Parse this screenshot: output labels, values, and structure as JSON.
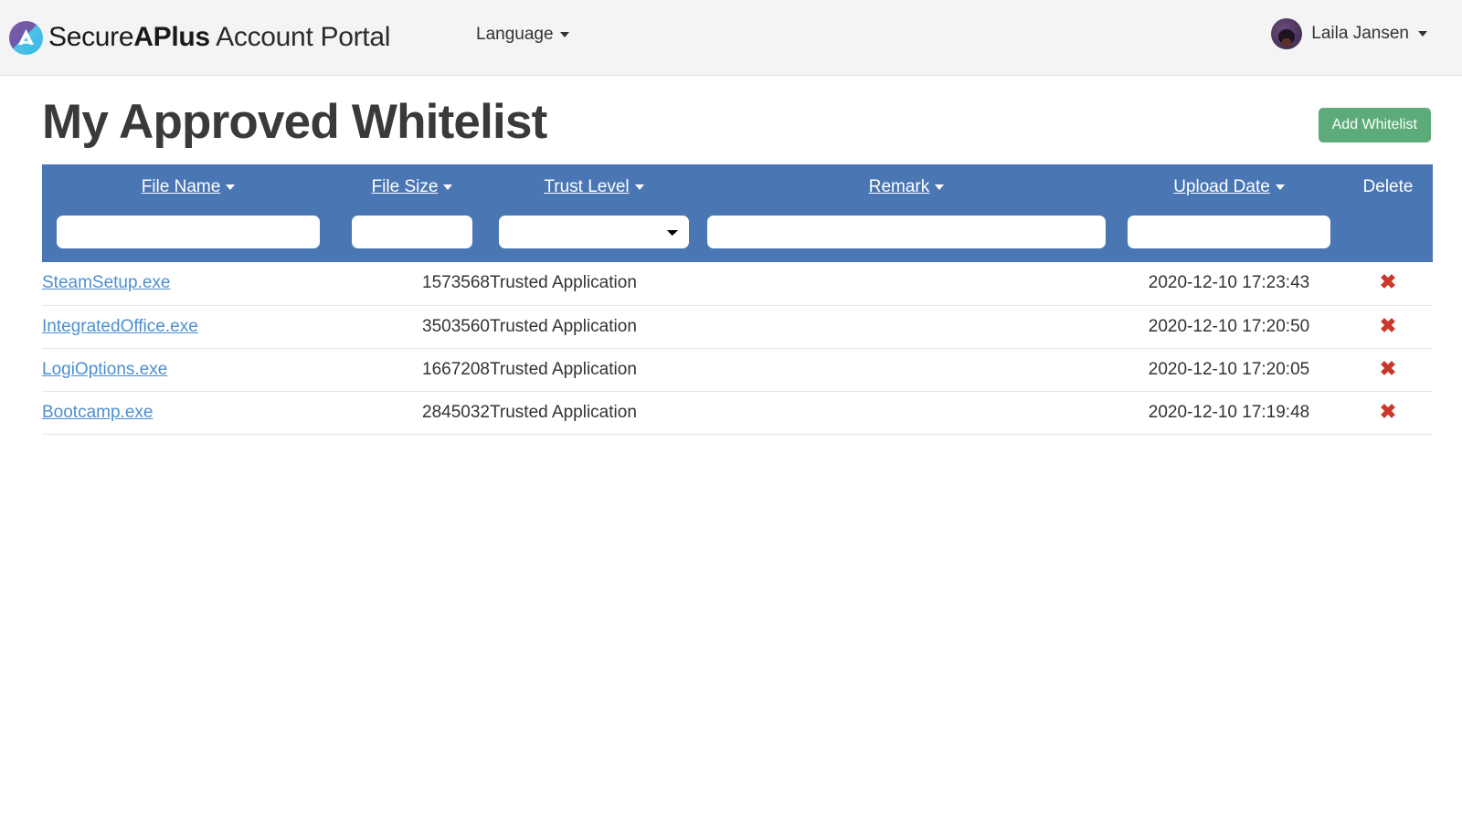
{
  "navbar": {
    "brand_secure": "Secure",
    "brand_aplus": "APlus",
    "brand_portal": " Account Portal",
    "logo_icon": "secureaplus-logo-icon",
    "language_label": "Language",
    "language_caret_icon": "caret-down-icon",
    "user_name": "Laila Jansen",
    "user_caret_icon": "caret-down-icon",
    "avatar_icon": "user-avatar"
  },
  "page": {
    "title": "My Approved Whitelist",
    "add_button_label": "Add Whitelist"
  },
  "table": {
    "columns": [
      {
        "label": "File Name",
        "sortable": true,
        "caret_icon": "caret-down-icon"
      },
      {
        "label": "File Size",
        "sortable": true,
        "caret_icon": "caret-down-icon"
      },
      {
        "label": "Trust Level",
        "sortable": true,
        "caret_icon": "caret-down-icon"
      },
      {
        "label": "Remark",
        "sortable": true,
        "caret_icon": "caret-down-icon"
      },
      {
        "label": "Upload Date",
        "sortable": true,
        "caret_icon": "caret-down-icon"
      },
      {
        "label": "Delete",
        "sortable": false,
        "caret_icon": ""
      }
    ],
    "filters": {
      "file_name_value": "",
      "file_name_placeholder": "",
      "file_size_value": "",
      "file_size_placeholder": "",
      "trust_level_selected": "",
      "trust_level_options": [
        ""
      ],
      "remark_value": "",
      "remark_placeholder": "",
      "upload_date_value": "",
      "upload_date_placeholder": ""
    },
    "rows": [
      {
        "file_name": "SteamSetup.exe",
        "file_size": "1573568",
        "trust_level": "Trusted Application",
        "remark": "",
        "upload_date": "2020-12-10 17:23:43",
        "delete_icon": "✖"
      },
      {
        "file_name": "IntegratedOffice.exe",
        "file_size": "3503560",
        "trust_level": "Trusted Application",
        "remark": "",
        "upload_date": "2020-12-10 17:20:50",
        "delete_icon": "✖"
      },
      {
        "file_name": "LogiOptions.exe",
        "file_size": "1667208",
        "trust_level": "Trusted Application",
        "remark": "",
        "upload_date": "2020-12-10 17:20:05",
        "delete_icon": "✖"
      },
      {
        "file_name": "Bootcamp.exe",
        "file_size": "2845032",
        "trust_level": "Trusted Application",
        "remark": "",
        "upload_date": "2020-12-10 17:19:48",
        "delete_icon": "✖"
      }
    ]
  },
  "colors": {
    "header_blue": "#4a77b4",
    "add_button_green": "#5cab78",
    "link_blue": "#4e8fd1",
    "delete_red": "#c9392b",
    "navbar_bg": "#f4f4f4"
  }
}
